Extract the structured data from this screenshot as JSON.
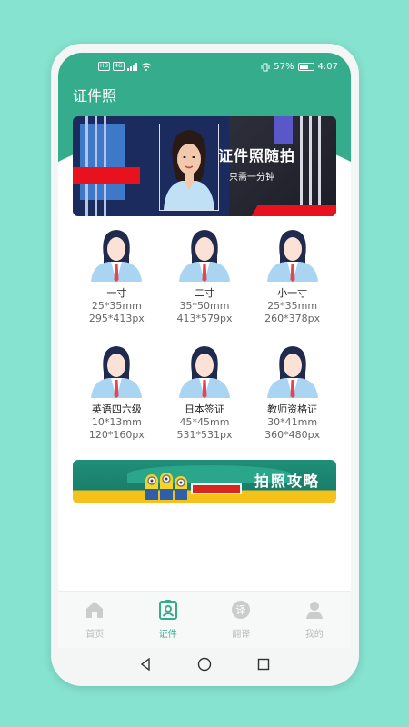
{
  "status": {
    "left_icons": [
      "HD",
      "4G"
    ],
    "battery": "57%",
    "time": "4:07"
  },
  "header": {
    "title": "证件照"
  },
  "banner": {
    "title": "证件照随拍",
    "subtitle": "只需一分钟"
  },
  "photo_types": [
    {
      "name": "一寸",
      "mm": "25*35mm",
      "px": "295*413px"
    },
    {
      "name": "二寸",
      "mm": "35*50mm",
      "px": "413*579px"
    },
    {
      "name": "小一寸",
      "mm": "25*35mm",
      "px": "260*378px"
    },
    {
      "name": "英语四六级",
      "mm": "10*13mm",
      "px": "120*160px"
    },
    {
      "name": "日本签证",
      "mm": "45*45mm",
      "px": "531*531px"
    },
    {
      "name": "教师资格证",
      "mm": "30*41mm",
      "px": "360*480px"
    }
  ],
  "promo": {
    "title": "拍照攻略"
  },
  "tabs": [
    {
      "label": "首页",
      "icon": "home-icon"
    },
    {
      "label": "证件",
      "icon": "id-badge-icon"
    },
    {
      "label": "翻译",
      "icon": "translate-icon",
      "glyph": "译"
    },
    {
      "label": "我的",
      "icon": "user-icon"
    }
  ],
  "colors": {
    "accent": "#35ad8c",
    "background": "#86e3cf",
    "tab_inactive": "#b7bcbb"
  }
}
